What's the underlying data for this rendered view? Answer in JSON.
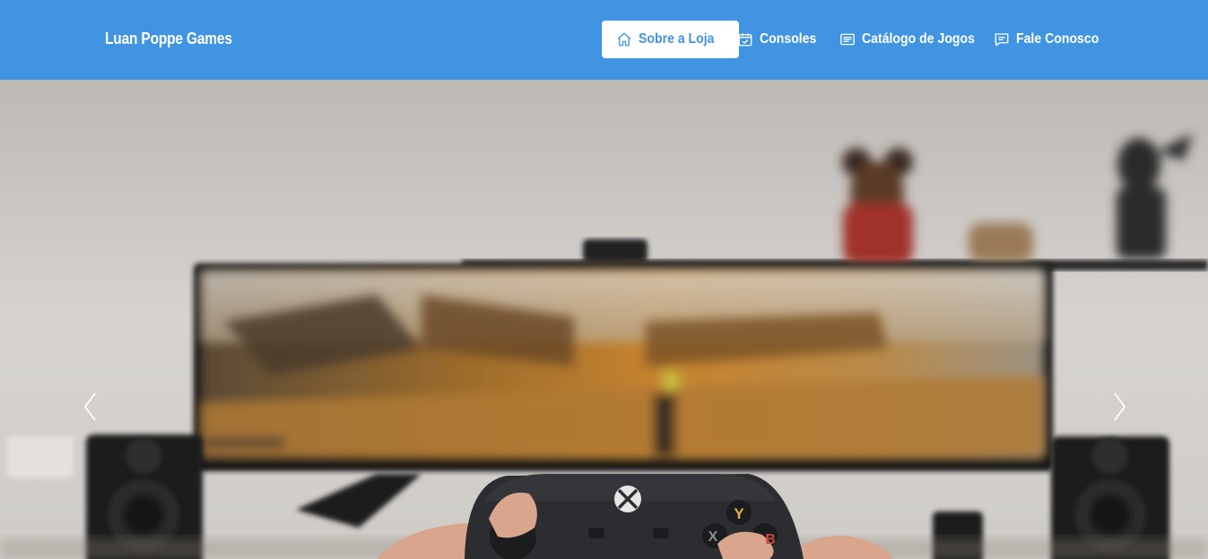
{
  "brand": "Luan Poppe Games",
  "nav": {
    "items": [
      {
        "label": "Sobre a Loja",
        "icon": "home-icon",
        "active": true
      },
      {
        "label": "Consoles",
        "icon": "calendar-check-icon",
        "active": false
      },
      {
        "label": "Catálogo de Jogos",
        "icon": "list-icon",
        "active": false
      },
      {
        "label": "Fale Conosco",
        "icon": "chat-icon",
        "active": false
      }
    ]
  },
  "carousel": {
    "prev_icon": "chevron-left-icon",
    "next_icon": "chevron-right-icon",
    "image": "hero-photo-gaming-setup"
  },
  "controller": {
    "y": "Y",
    "b": "B",
    "x": "X"
  },
  "colors": {
    "navbar": "#4094e2",
    "active_bg": "#ffffff",
    "active_text": "#4094e2"
  }
}
